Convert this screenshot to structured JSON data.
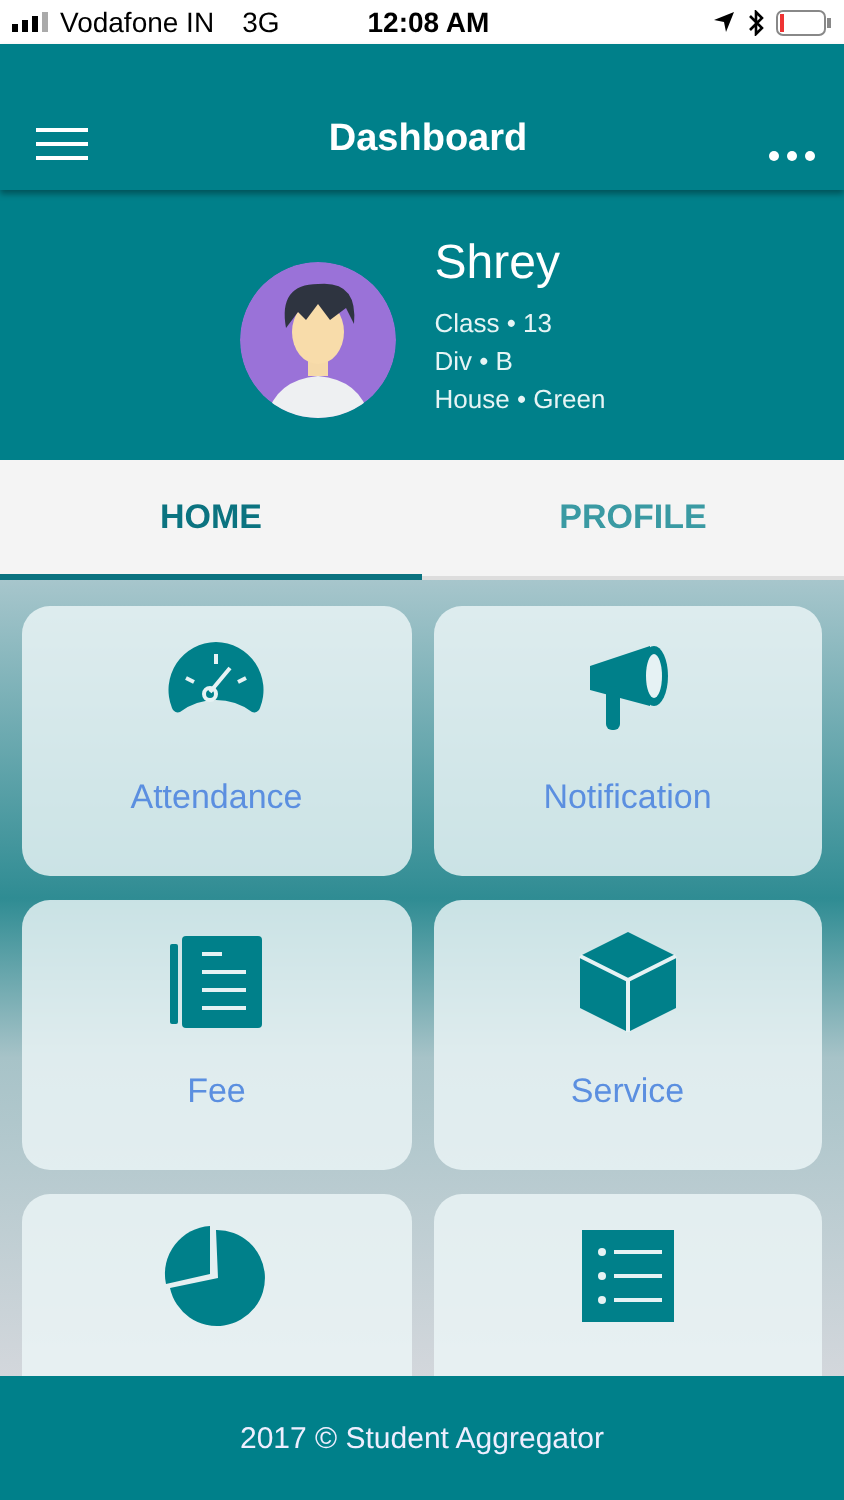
{
  "status_bar": {
    "carrier": "Vodafone IN",
    "network": "3G",
    "time": "12:08 AM"
  },
  "header": {
    "title": "Dashboard"
  },
  "profile": {
    "name": "Shrey",
    "details": [
      "Class • 13",
      "Div • B",
      "House • Green"
    ]
  },
  "tabs": [
    {
      "label": "HOME",
      "selected": true
    },
    {
      "label": "PROFILE",
      "selected": false
    }
  ],
  "tiles": [
    {
      "kind": "gauge",
      "label": "Attendance"
    },
    {
      "kind": "megaphone",
      "label": "Notification"
    },
    {
      "kind": "document",
      "label": "Fee"
    },
    {
      "kind": "cube",
      "label": "Service"
    },
    {
      "kind": "pie"
    },
    {
      "kind": "list"
    }
  ],
  "footer": {
    "text": "2017 © Student Aggregator"
  }
}
